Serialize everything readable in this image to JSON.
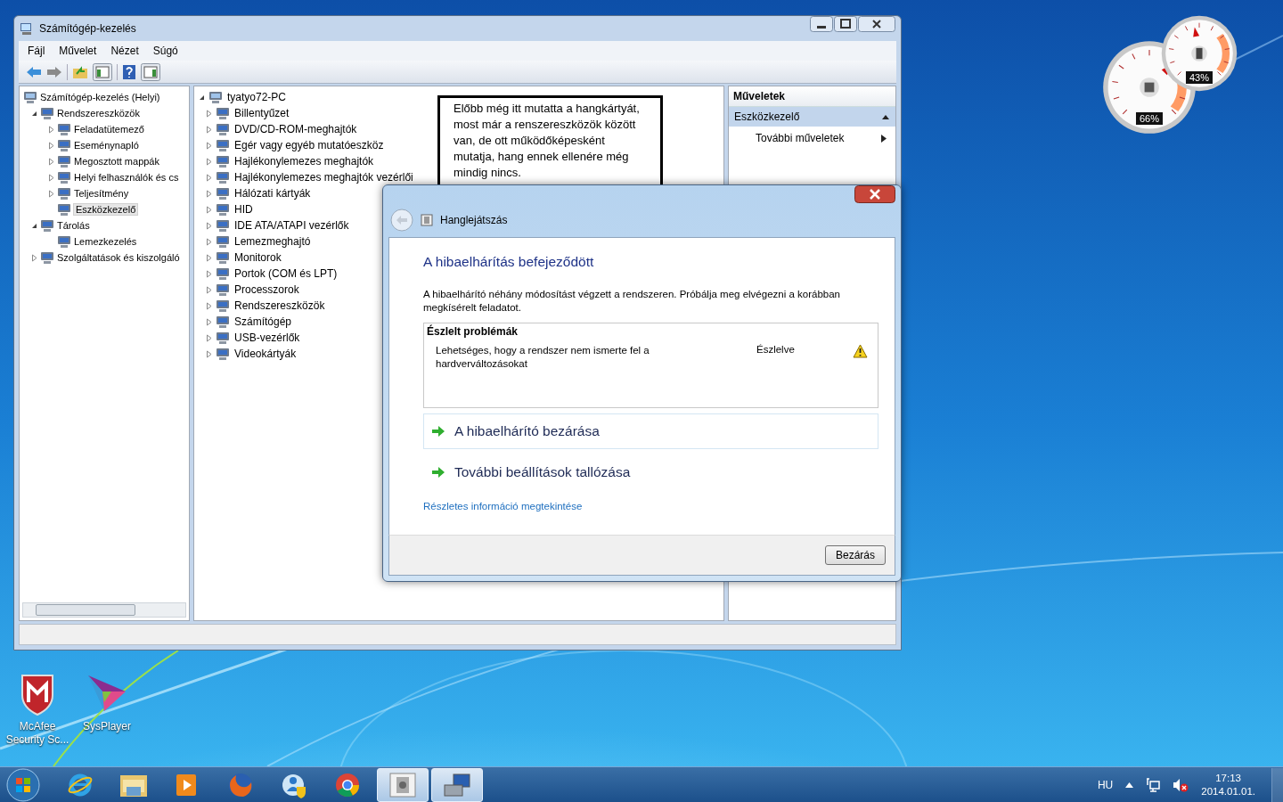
{
  "desktop": {
    "icons": [
      {
        "kind": "shield",
        "label": "McAfee Security Sc..."
      },
      {
        "kind": "player",
        "label": "SysPlayer"
      }
    ]
  },
  "gadgets": [
    {
      "kind": "cpu",
      "reading": "66%"
    },
    {
      "kind": "memory",
      "reading": "43%"
    }
  ],
  "window": {
    "title": "Számítógép-kezelés",
    "menu": [
      "Fájl",
      "Művelet",
      "Nézet",
      "Súgó"
    ]
  },
  "tree": [
    {
      "label": "Számítógép-kezelés (Helyi)",
      "selected": false,
      "children": [
        {
          "label": "Rendszereszközök",
          "expanded": true,
          "selected": false,
          "children": [
            {
              "label": "Feladatütemező",
              "expanded": false,
              "selected": false
            },
            {
              "label": "Eseménynapló",
              "expanded": false,
              "selected": false
            },
            {
              "label": "Megosztott mappák",
              "expanded": false,
              "selected": false
            },
            {
              "label": "Helyi felhasználók és cs",
              "expanded": false,
              "selected": false
            },
            {
              "label": "Teljesítmény",
              "expanded": false,
              "selected": false
            },
            {
              "label": "Eszközkezelő",
              "selected": true
            }
          ]
        },
        {
          "label": "Tárolás",
          "expanded": true,
          "selected": false,
          "children": [
            {
              "label": "Lemezkezelés",
              "selected": false
            }
          ]
        },
        {
          "label": "Szolgáltatások és kiszolgáló",
          "expanded": false,
          "selected": false
        }
      ]
    }
  ],
  "device_tree": [
    {
      "label": "tyatyo72-PC",
      "expanded": true,
      "children": [
        {
          "label": "Billentyűzet",
          "expanded": false
        },
        {
          "label": "DVD/CD-ROM-meghajtók",
          "expanded": false
        },
        {
          "label": "Egér vagy egyéb mutatóeszköz",
          "expanded": false
        },
        {
          "label": "Hajlékonylemezes meghajtók",
          "expanded": false
        },
        {
          "label": "Hajlékonylemezes meghajtók vezérlői",
          "expanded": false
        },
        {
          "label": "Hálózati kártyák",
          "expanded": false
        },
        {
          "label": "HID",
          "expanded": false
        },
        {
          "label": "IDE ATA/ATAPI vezérlők",
          "expanded": false
        },
        {
          "label": "Lemezmeghajtó",
          "expanded": false
        },
        {
          "label": "Monitorok",
          "expanded": false
        },
        {
          "label": "Portok (COM és LPT)",
          "expanded": false
        },
        {
          "label": "Processzorok",
          "expanded": false
        },
        {
          "label": "Rendszereszközök",
          "expanded": false
        },
        {
          "label": "Számítógép",
          "expanded": false
        },
        {
          "label": "USB-vezérlők",
          "expanded": false
        },
        {
          "label": "Videokártyák",
          "expanded": false
        }
      ]
    }
  ],
  "note": "Előbb még itt mutatta a hangkártyát, most már a renszereszközök között van, de ott működőképesként mutatja, hang ennek ellenére még mindig nincs.",
  "actions": {
    "title": "Műveletek",
    "section": {
      "label": "Eszközkezelő",
      "expanded": true
    },
    "items": [
      "További műveletek"
    ]
  },
  "dialog": {
    "nav_title": "Hanglejátszás",
    "heading": "A hibaelhárítás befejeződött",
    "message": "A hibaelhárító néhány módosítást végzett a rendszeren. Próbálja meg elvégezni a korábban megkísérelt feladatot.",
    "problems": {
      "title": "Észlelt problémák",
      "rows": [
        {
          "problem": "Lehetséges, hogy a rendszer nem ismerte fel a hardverváltozásokat",
          "status": "Észlelve"
        }
      ]
    },
    "options": [
      {
        "label": "A hibaelhárító bezárása",
        "selected": true
      },
      {
        "label": "További beállítások tallózása",
        "selected": false
      }
    ],
    "link": "Részletes információ megtekintése",
    "button": "Bezárás"
  },
  "taskbar": {
    "items": [
      {
        "kind": "browser-e",
        "running": false
      },
      {
        "kind": "folder",
        "running": false
      },
      {
        "kind": "media",
        "running": false
      },
      {
        "kind": "fox",
        "running": false
      },
      {
        "kind": "shield-person",
        "running": false
      },
      {
        "kind": "circle-browser",
        "running": false
      },
      {
        "kind": "speaker-app",
        "running": true
      },
      {
        "kind": "computer-app",
        "running": true
      }
    ],
    "language": "HU",
    "time": "17:13",
    "date": "2014.01.01."
  }
}
